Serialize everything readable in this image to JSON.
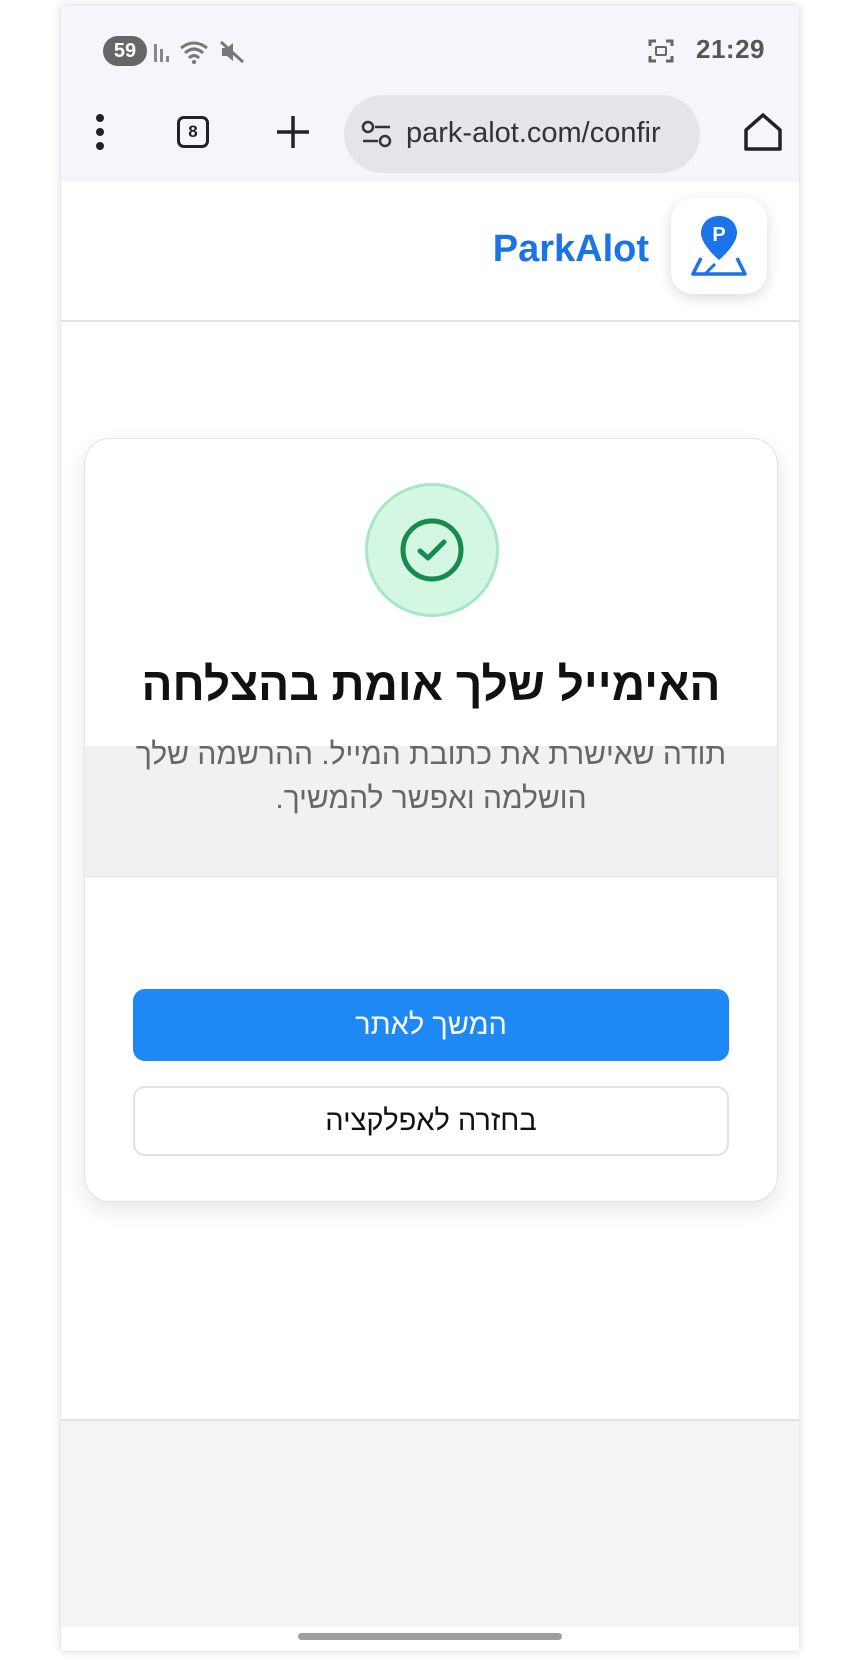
{
  "status_bar": {
    "notification_count": "59",
    "time": "21:29",
    "icons": [
      "signal-icon",
      "wifi-icon",
      "mute-icon",
      "screenshot-icon"
    ]
  },
  "browser": {
    "tab_count": "8",
    "url": "park-alot.com/confir",
    "icons": [
      "menu-icon",
      "tabs-icon",
      "new-tab-icon",
      "site-settings-icon",
      "home-icon"
    ]
  },
  "header": {
    "brand": "ParkAlot",
    "logo_icon": "map-pin-parking-icon",
    "logo_letter": "P"
  },
  "card": {
    "icon": "check-circle-icon",
    "title": "האימייל שלך אומת בהצלחה",
    "subtitle": "תודה שאישרת את כתובת המייל. ההרשמה שלך הושלמה ואפשר להמשיך.",
    "primary_button": "המשך לאתר",
    "secondary_button": "בחזרה לאפלקציה"
  },
  "colors": {
    "brand": "#1a73e8",
    "primary_button": "#1e88f5",
    "success_bg": "#d4f7e4",
    "success_icon": "#188a4e"
  }
}
